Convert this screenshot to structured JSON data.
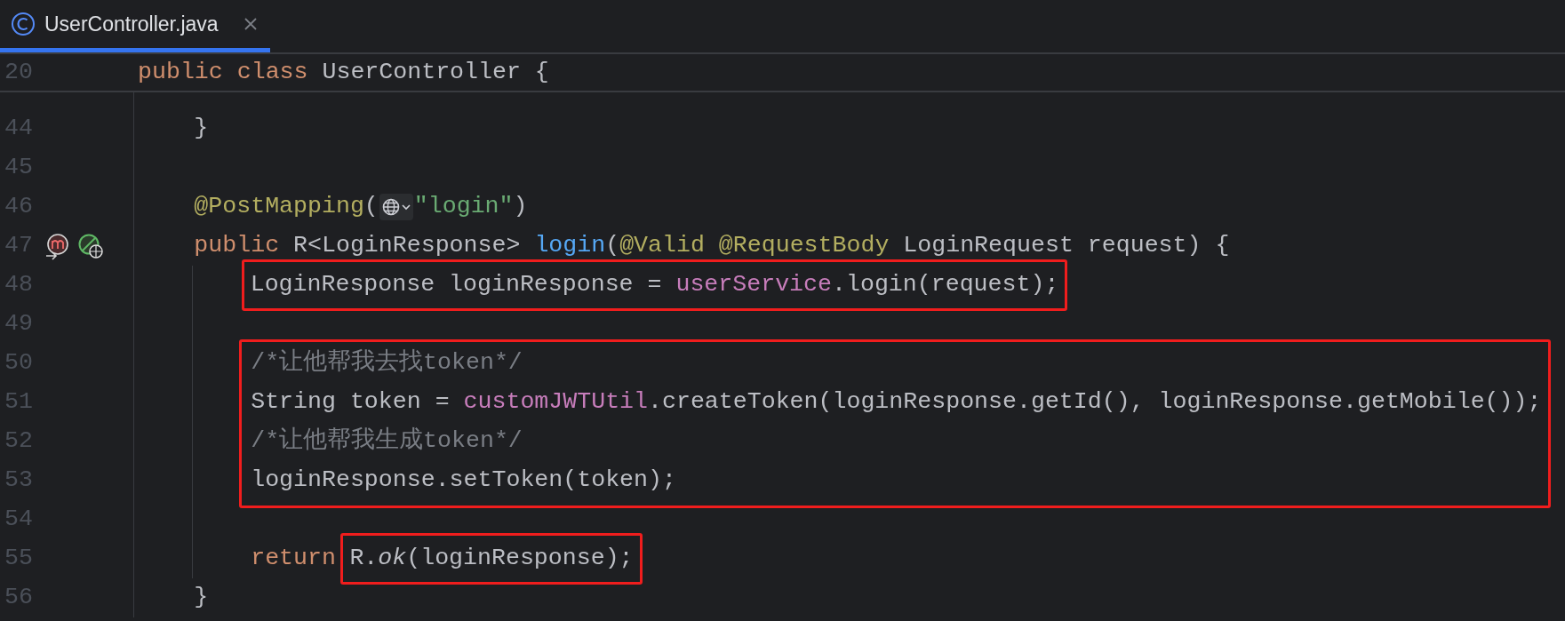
{
  "tab": {
    "title": "UserController.java",
    "selected": true
  },
  "sticky_line": {
    "number": "20",
    "tokens": [
      {
        "kind": "keyword",
        "text": "public class "
      },
      {
        "kind": "plain",
        "text": "UserController {"
      }
    ]
  },
  "lines": [
    {
      "kind": "line",
      "number": "44",
      "tokens": [
        {
          "kind": "plain",
          "text": "    }"
        }
      ]
    },
    {
      "kind": "line",
      "number": "45"
    },
    {
      "kind": "line",
      "number": "46",
      "tokens": [
        {
          "kind": "annotation",
          "text": "    @PostMapping"
        },
        {
          "kind": "plain",
          "text": "("
        },
        {
          "kind": "inlay"
        },
        {
          "kind": "string",
          "text": "\"login\""
        },
        {
          "kind": "plain",
          "text": ")"
        }
      ]
    },
    {
      "kind": "line",
      "number": "47",
      "gutter_icons": [
        {
          "kind": "method"
        },
        {
          "kind": "endpoint"
        }
      ],
      "tokens": [
        {
          "kind": "keyword",
          "text": "    public "
        },
        {
          "kind": "plain",
          "text": "R<LoginResponse> "
        },
        {
          "kind": "method",
          "text": "login"
        },
        {
          "kind": "plain",
          "text": "("
        },
        {
          "kind": "annotation",
          "text": "@Valid @RequestBody "
        },
        {
          "kind": "plain",
          "text": "LoginRequest request) {"
        }
      ]
    },
    {
      "kind": "line",
      "number": "48",
      "tokens": [
        {
          "kind": "box",
          "tokens": [
            {
              "kind": "plain",
              "text": "        LoginResponse loginResponse = "
            },
            {
              "kind": "field",
              "text": "userService"
            },
            {
              "kind": "plain",
              "text": ".login(request);"
            }
          ]
        }
      ]
    },
    {
      "kind": "line",
      "number": "49"
    },
    {
      "kind": "group",
      "lines": [
        {
          "kind": "line",
          "number": "50",
          "tokens": [
            {
              "kind": "comment",
              "text": "        /*让他帮我去找token*/"
            }
          ]
        },
        {
          "kind": "line",
          "number": "51",
          "tokens": [
            {
              "kind": "plain",
              "text": "        String token = "
            },
            {
              "kind": "field",
              "text": "customJWTUtil"
            },
            {
              "kind": "plain",
              "text": ".createToken(loginResponse.getId(), loginResponse.getMobile());"
            }
          ]
        },
        {
          "kind": "line",
          "number": "52",
          "tokens": [
            {
              "kind": "comment",
              "text": "        /*让他帮我生成token*/"
            }
          ]
        },
        {
          "kind": "line",
          "number": "53",
          "tokens": [
            {
              "kind": "plain",
              "text": "        loginResponse.setToken(token);"
            }
          ]
        }
      ]
    },
    {
      "kind": "line",
      "number": "54"
    },
    {
      "kind": "line",
      "number": "55",
      "tokens": [
        {
          "kind": "keyword",
          "text": "        return "
        },
        {
          "kind": "box",
          "tokens": [
            {
              "kind": "plain",
              "text": "R."
            },
            {
              "kind": "italic",
              "text": "ok"
            },
            {
              "kind": "plain",
              "text": "(loginResponse);"
            }
          ]
        }
      ]
    },
    {
      "kind": "line",
      "number": "56",
      "tokens": [
        {
          "kind": "plain",
          "text": "    }"
        }
      ]
    }
  ]
}
